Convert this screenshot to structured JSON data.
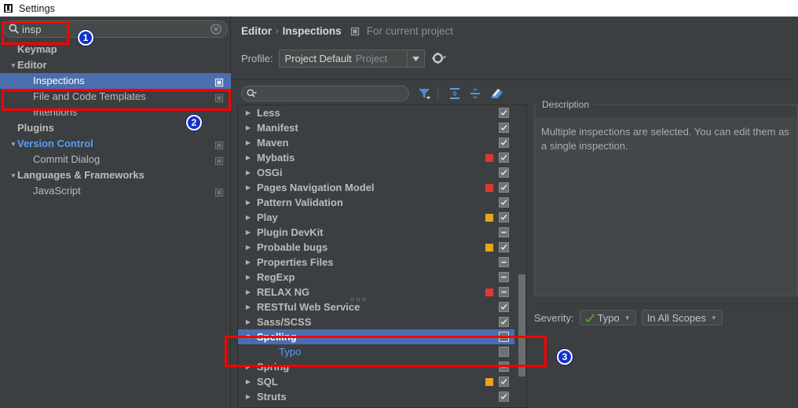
{
  "window": {
    "title": "Settings",
    "icon": "settings-window-icon"
  },
  "sidebar": {
    "search": {
      "value": "insp",
      "icon": "search-icon",
      "clear_icon": "clear-icon"
    },
    "items": [
      {
        "label": "Keymap",
        "level": 1,
        "bold": true,
        "twisty": "",
        "selected": false,
        "accent": false,
        "copy_indicator": false
      },
      {
        "label": "Editor",
        "level": 1,
        "bold": true,
        "twisty": "▼",
        "selected": false,
        "accent": false,
        "copy_indicator": false
      },
      {
        "label": "Inspections",
        "level": 2,
        "bold": false,
        "twisty": "",
        "selected": true,
        "accent": false,
        "copy_indicator": true
      },
      {
        "label": "File and Code Templates",
        "level": 2,
        "bold": false,
        "twisty": "",
        "selected": false,
        "accent": false,
        "copy_indicator": true
      },
      {
        "label": "Intentions",
        "level": 2,
        "bold": false,
        "twisty": "",
        "selected": false,
        "accent": false,
        "copy_indicator": false
      },
      {
        "label": "Plugins",
        "level": 1,
        "bold": true,
        "twisty": "",
        "selected": false,
        "accent": false,
        "copy_indicator": false
      },
      {
        "label": "Version Control",
        "level": 1,
        "bold": true,
        "twisty": "▼",
        "selected": false,
        "accent": true,
        "copy_indicator": true
      },
      {
        "label": "Commit Dialog",
        "level": 2,
        "bold": false,
        "twisty": "",
        "selected": false,
        "accent": false,
        "copy_indicator": true
      },
      {
        "label": "Languages & Frameworks",
        "level": 1,
        "bold": true,
        "twisty": "▼",
        "selected": false,
        "accent": false,
        "copy_indicator": false
      },
      {
        "label": "JavaScript",
        "level": 2,
        "bold": false,
        "twisty": "",
        "selected": false,
        "accent": false,
        "copy_indicator": true
      }
    ]
  },
  "content": {
    "breadcrumb": {
      "parts": [
        "Editor",
        "Inspections"
      ],
      "separator": "›",
      "note": "For current project",
      "note_icon": "project-scope-icon"
    },
    "profile": {
      "label": "Profile:",
      "value": "Project Default",
      "scope": "Project",
      "dropdown_icon": "chevron-down-icon",
      "gear_icon": "gear-icon"
    },
    "toolbar": {
      "filter_placeholder": "",
      "filter_value": "",
      "search_icon": "search-dropdown-icon",
      "buttons": [
        {
          "name": "filter-button",
          "icon": "funnel-icon"
        },
        {
          "name": "expand-all-button",
          "icon": "expand-all-icon"
        },
        {
          "name": "collapse-all-button",
          "icon": "collapse-all-icon"
        },
        {
          "name": "reset-button",
          "icon": "eraser-icon"
        }
      ]
    },
    "tree": [
      {
        "label": "Less",
        "expandable": true,
        "child": false,
        "checkbox": "checked",
        "severity": "",
        "selected": false,
        "twisty": "▶"
      },
      {
        "label": "Manifest",
        "expandable": true,
        "child": false,
        "checkbox": "checked",
        "severity": "",
        "selected": false,
        "twisty": "▶"
      },
      {
        "label": "Maven",
        "expandable": true,
        "child": false,
        "checkbox": "checked",
        "severity": "",
        "selected": false,
        "twisty": "▶"
      },
      {
        "label": "Mybatis",
        "expandable": true,
        "child": false,
        "checkbox": "checked",
        "severity": "#db3a34",
        "selected": false,
        "twisty": "▶"
      },
      {
        "label": "OSGi",
        "expandable": true,
        "child": false,
        "checkbox": "checked",
        "severity": "",
        "selected": false,
        "twisty": "▶"
      },
      {
        "label": "Pages Navigation Model",
        "expandable": true,
        "child": false,
        "checkbox": "checked",
        "severity": "#db3a34",
        "selected": false,
        "twisty": "▶"
      },
      {
        "label": "Pattern Validation",
        "expandable": true,
        "child": false,
        "checkbox": "checked",
        "severity": "",
        "selected": false,
        "twisty": "▶"
      },
      {
        "label": "Play",
        "expandable": true,
        "child": false,
        "checkbox": "checked",
        "severity": "#eaa21f",
        "selected": false,
        "twisty": "▶"
      },
      {
        "label": "Plugin DevKit",
        "expandable": true,
        "child": false,
        "checkbox": "partial",
        "severity": "",
        "selected": false,
        "twisty": "▶"
      },
      {
        "label": "Probable bugs",
        "expandable": true,
        "child": false,
        "checkbox": "checked",
        "severity": "#eaa21f",
        "selected": false,
        "twisty": "▶"
      },
      {
        "label": "Properties Files",
        "expandable": true,
        "child": false,
        "checkbox": "partial",
        "severity": "",
        "selected": false,
        "twisty": "▶"
      },
      {
        "label": "RegExp",
        "expandable": true,
        "child": false,
        "checkbox": "partial",
        "severity": "",
        "selected": false,
        "twisty": "▶"
      },
      {
        "label": "RELAX NG",
        "expandable": true,
        "child": false,
        "checkbox": "partial",
        "severity": "#db3a34",
        "selected": false,
        "twisty": "▶"
      },
      {
        "label": "RESTful Web Service",
        "expandable": true,
        "child": false,
        "checkbox": "checked",
        "severity": "",
        "selected": false,
        "twisty": "▶"
      },
      {
        "label": "Sass/SCSS",
        "expandable": true,
        "child": false,
        "checkbox": "checked",
        "severity": "",
        "selected": false,
        "twisty": "▶"
      },
      {
        "label": "Spelling",
        "expandable": true,
        "child": false,
        "checkbox": "unchecked",
        "severity": "",
        "selected": true,
        "twisty": "▼"
      },
      {
        "label": "Typo",
        "expandable": false,
        "child": true,
        "checkbox": "unchecked",
        "severity": "",
        "selected": false,
        "twisty": ""
      },
      {
        "label": "Spring",
        "expandable": true,
        "child": false,
        "checkbox": "partial",
        "severity": "",
        "selected": false,
        "twisty": "▶"
      },
      {
        "label": "SQL",
        "expandable": true,
        "child": false,
        "checkbox": "checked",
        "severity": "#eaa21f",
        "selected": false,
        "twisty": "▶"
      },
      {
        "label": "Struts",
        "expandable": true,
        "child": false,
        "checkbox": "checked",
        "severity": "",
        "selected": false,
        "twisty": "▶"
      }
    ],
    "description": {
      "title": "Description",
      "text": "Multiple inspections are selected. You can edit them as a single inspection."
    },
    "severity": {
      "label": "Severity:",
      "value": "Typo",
      "value_icon": "typo-severity-icon",
      "scope": "In All Scopes",
      "caret_icon": "chevron-down-icon"
    }
  },
  "annotations": {
    "badges": [
      {
        "number": "1"
      },
      {
        "number": "2"
      },
      {
        "number": "3"
      }
    ],
    "highlight_color": "#ff0000"
  }
}
